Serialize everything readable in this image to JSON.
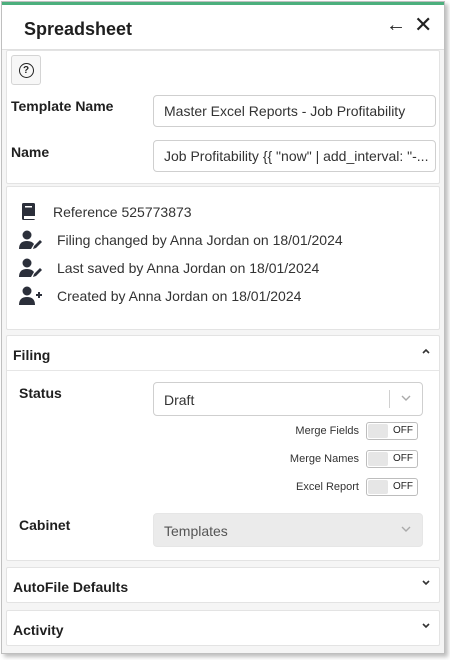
{
  "header": {
    "title": "Spreadsheet",
    "back_glyph": "←",
    "close_glyph": "✕"
  },
  "help": {
    "glyph": "?"
  },
  "form": {
    "template_label": "Template Name",
    "template_value": "Master Excel Reports  - Job Profitability",
    "name_label": "Name",
    "name_value": "Job Profitability {{ \"now\" | add_interval: \"-..."
  },
  "info": {
    "reference": "Reference 525773873",
    "filing_changed": "Filing changed by Anna Jordan on 18/01/2024",
    "last_saved": "Last saved by Anna Jordan on 18/01/2024",
    "created": "Created by Anna Jordan on 18/01/2024"
  },
  "filing": {
    "title": "Filing",
    "status_label": "Status",
    "status_value": "Draft",
    "toggles": [
      {
        "label": "Merge Fields",
        "state": "OFF"
      },
      {
        "label": "Merge Names",
        "state": "OFF"
      },
      {
        "label": "Excel Report",
        "state": "OFF"
      }
    ],
    "cabinet_label": "Cabinet",
    "cabinet_value": "Templates"
  },
  "sections": {
    "autofile": "AutoFile Defaults",
    "activity": "Activity"
  },
  "icons": {
    "up": "chevron-up-icon",
    "down": "chevron-down-icon",
    "book": "book-icon",
    "user_edit": "user-edit-icon",
    "user_add": "user-add-icon"
  },
  "colors": {
    "accent": "#4caf7d"
  }
}
